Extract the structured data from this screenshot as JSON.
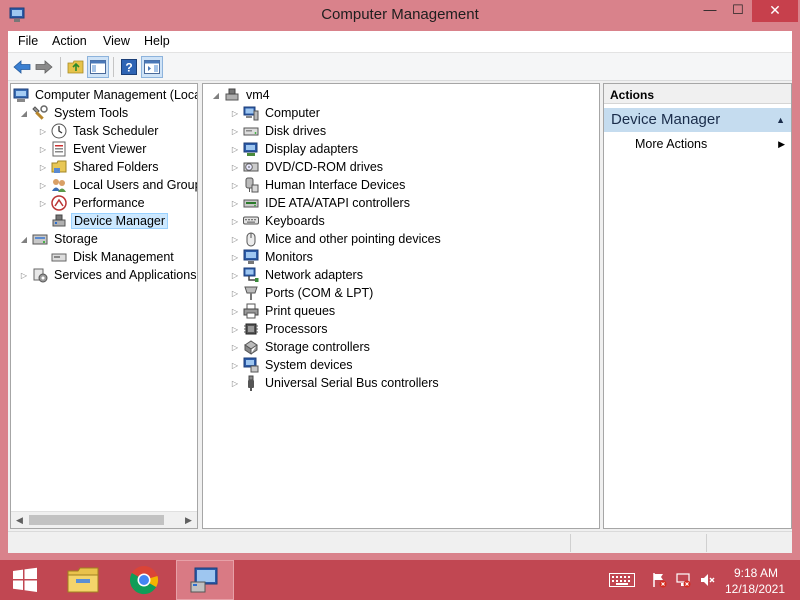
{
  "window": {
    "title": "Computer Management"
  },
  "menu": [
    "File",
    "Action",
    "View",
    "Help"
  ],
  "tree": {
    "root": "Computer Management (Local",
    "system_tools": "System Tools",
    "task_scheduler": "Task Scheduler",
    "event_viewer": "Event Viewer",
    "shared_folders": "Shared Folders",
    "local_users": "Local Users and Groups",
    "performance": "Performance",
    "device_manager": "Device Manager",
    "storage": "Storage",
    "disk_management": "Disk Management",
    "services": "Services and Applications"
  },
  "devices": {
    "root": "vm4",
    "categories": [
      "Computer",
      "Disk drives",
      "Display adapters",
      "DVD/CD-ROM drives",
      "Human Interface Devices",
      "IDE ATA/ATAPI controllers",
      "Keyboards",
      "Mice and other pointing devices",
      "Monitors",
      "Network adapters",
      "Ports (COM & LPT)",
      "Print queues",
      "Processors",
      "Storage controllers",
      "System devices",
      "Universal Serial Bus controllers"
    ]
  },
  "actions": {
    "header": "Actions",
    "section": "Device Manager",
    "more": "More Actions"
  },
  "clock": {
    "time": "9:18 AM",
    "date": "12/18/2021"
  },
  "colors": {
    "accent": "#c94f5a",
    "taskbar": "#c14752",
    "selection": "#cce8ff"
  }
}
